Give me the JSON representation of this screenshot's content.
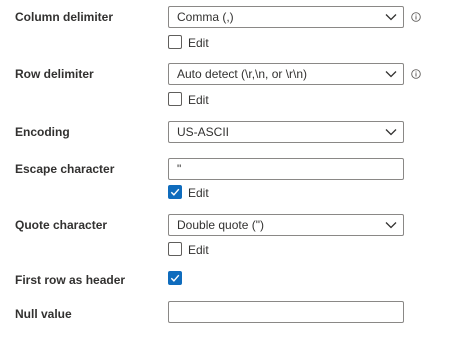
{
  "settings": {
    "column_delimiter": {
      "label": "Column delimiter",
      "value": "Comma (,)",
      "edit_label": "Edit",
      "edit_checked": false
    },
    "row_delimiter": {
      "label": "Row delimiter",
      "value": "Auto detect (\\r,\\n, or \\r\\n)",
      "edit_label": "Edit",
      "edit_checked": false
    },
    "encoding": {
      "label": "Encoding",
      "value": "US-ASCII"
    },
    "escape_character": {
      "label": "Escape character",
      "value": "\"",
      "edit_label": "Edit",
      "edit_checked": true
    },
    "quote_character": {
      "label": "Quote character",
      "value": "Double quote (\")",
      "edit_label": "Edit",
      "edit_checked": false
    },
    "first_row_header": {
      "label": "First row as header",
      "checked": true
    },
    "null_value": {
      "label": "Null value",
      "value": ""
    }
  },
  "colors": {
    "accent": "#0f6cbd",
    "border": "#8a8886",
    "text": "#323130"
  },
  "icons": {
    "dropdown": "chevron-down-icon",
    "info": "info-icon",
    "check": "checkmark-icon"
  }
}
